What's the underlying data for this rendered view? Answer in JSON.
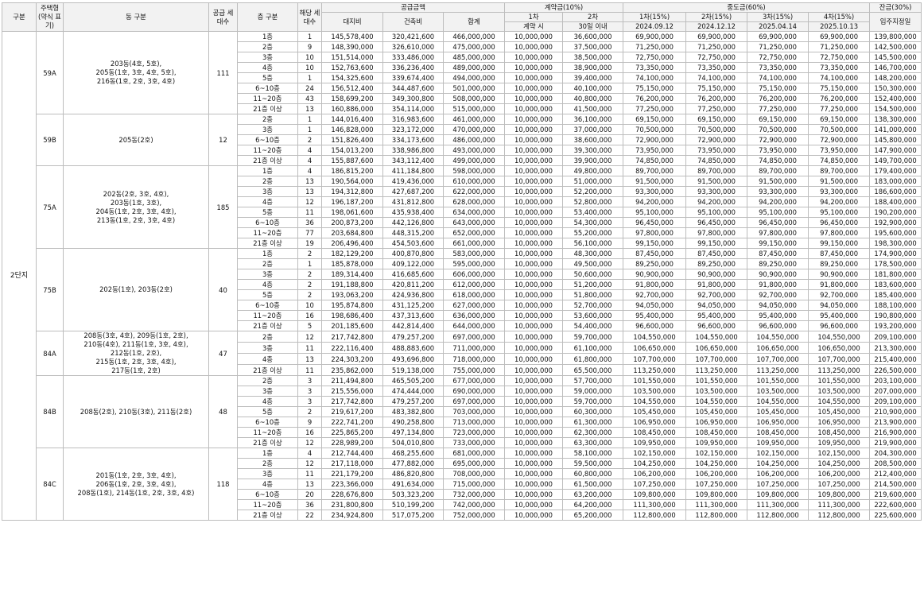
{
  "header": {
    "r1": [
      "구분",
      "주택형 (약식 표기)",
      "동 구분",
      "공급 세대수",
      "층 구분",
      "해당 세대수",
      "공급금액",
      "계약금(10%)",
      "중도금(60%)",
      "잔금(30%)"
    ],
    "r2": [
      "대지비",
      "건축비",
      "합계",
      "1차",
      "2차",
      "1차(15%)",
      "2차(15%)",
      "3차(15%)",
      "4차(15%)",
      "입주지정일"
    ],
    "r3": [
      "계약 시",
      "30일 이내",
      "2024.09.12",
      "2024.12.12",
      "2025.04.14",
      "2025.10.13"
    ]
  },
  "complex": "2단지",
  "groups": [
    {
      "type": "59A",
      "dong": "203동(4호, 5호),\n205동(1호, 3호, 4호, 5호),\n216동(1호, 2호, 3호, 4호)",
      "total": "111",
      "rows": [
        [
          "1층",
          "1",
          "145,578,400",
          "320,421,600",
          "466,000,000",
          "10,000,000",
          "36,600,000",
          "69,900,000",
          "69,900,000",
          "69,900,000",
          "69,900,000",
          "139,800,000"
        ],
        [
          "2층",
          "9",
          "148,390,000",
          "326,610,000",
          "475,000,000",
          "10,000,000",
          "37,500,000",
          "71,250,000",
          "71,250,000",
          "71,250,000",
          "71,250,000",
          "142,500,000"
        ],
        [
          "3층",
          "10",
          "151,514,000",
          "333,486,000",
          "485,000,000",
          "10,000,000",
          "38,500,000",
          "72,750,000",
          "72,750,000",
          "72,750,000",
          "72,750,000",
          "145,500,000"
        ],
        [
          "4층",
          "10",
          "152,763,600",
          "336,236,400",
          "489,000,000",
          "10,000,000",
          "38,900,000",
          "73,350,000",
          "73,350,000",
          "73,350,000",
          "73,350,000",
          "146,700,000"
        ],
        [
          "5층",
          "1",
          "154,325,600",
          "339,674,400",
          "494,000,000",
          "10,000,000",
          "39,400,000",
          "74,100,000",
          "74,100,000",
          "74,100,000",
          "74,100,000",
          "148,200,000"
        ],
        [
          "6~10층",
          "24",
          "156,512,400",
          "344,487,600",
          "501,000,000",
          "10,000,000",
          "40,100,000",
          "75,150,000",
          "75,150,000",
          "75,150,000",
          "75,150,000",
          "150,300,000"
        ],
        [
          "11~20층",
          "43",
          "158,699,200",
          "349,300,800",
          "508,000,000",
          "10,000,000",
          "40,800,000",
          "76,200,000",
          "76,200,000",
          "76,200,000",
          "76,200,000",
          "152,400,000"
        ],
        [
          "21층 이상",
          "13",
          "160,886,000",
          "354,114,000",
          "515,000,000",
          "10,000,000",
          "41,500,000",
          "77,250,000",
          "77,250,000",
          "77,250,000",
          "77,250,000",
          "154,500,000"
        ]
      ]
    },
    {
      "type": "59B",
      "dong": "205동(2호)",
      "total": "12",
      "rows": [
        [
          "2층",
          "1",
          "144,016,400",
          "316,983,600",
          "461,000,000",
          "10,000,000",
          "36,100,000",
          "69,150,000",
          "69,150,000",
          "69,150,000",
          "69,150,000",
          "138,300,000"
        ],
        [
          "3층",
          "1",
          "146,828,000",
          "323,172,000",
          "470,000,000",
          "10,000,000",
          "37,000,000",
          "70,500,000",
          "70,500,000",
          "70,500,000",
          "70,500,000",
          "141,000,000"
        ],
        [
          "6~10층",
          "2",
          "151,826,400",
          "334,173,600",
          "486,000,000",
          "10,000,000",
          "38,600,000",
          "72,900,000",
          "72,900,000",
          "72,900,000",
          "72,900,000",
          "145,800,000"
        ],
        [
          "11~20층",
          "4",
          "154,013,200",
          "338,986,800",
          "493,000,000",
          "10,000,000",
          "39,300,000",
          "73,950,000",
          "73,950,000",
          "73,950,000",
          "73,950,000",
          "147,900,000"
        ],
        [
          "21층 이상",
          "4",
          "155,887,600",
          "343,112,400",
          "499,000,000",
          "10,000,000",
          "39,900,000",
          "74,850,000",
          "74,850,000",
          "74,850,000",
          "74,850,000",
          "149,700,000"
        ]
      ]
    },
    {
      "type": "75A",
      "dong": "202동(2호, 3호, 4호),\n203동(1호, 3호),\n204동(1호, 2호, 3호, 4호),\n213동(1호, 2호, 3호, 4호)",
      "total": "185",
      "rows": [
        [
          "1층",
          "4",
          "186,815,200",
          "411,184,800",
          "598,000,000",
          "10,000,000",
          "49,800,000",
          "89,700,000",
          "89,700,000",
          "89,700,000",
          "89,700,000",
          "179,400,000"
        ],
        [
          "2층",
          "13",
          "190,564,000",
          "419,436,000",
          "610,000,000",
          "10,000,000",
          "51,000,000",
          "91,500,000",
          "91,500,000",
          "91,500,000",
          "91,500,000",
          "183,000,000"
        ],
        [
          "3층",
          "13",
          "194,312,800",
          "427,687,200",
          "622,000,000",
          "10,000,000",
          "52,200,000",
          "93,300,000",
          "93,300,000",
          "93,300,000",
          "93,300,000",
          "186,600,000"
        ],
        [
          "4층",
          "12",
          "196,187,200",
          "431,812,800",
          "628,000,000",
          "10,000,000",
          "52,800,000",
          "94,200,000",
          "94,200,000",
          "94,200,000",
          "94,200,000",
          "188,400,000"
        ],
        [
          "5층",
          "11",
          "198,061,600",
          "435,938,400",
          "634,000,000",
          "10,000,000",
          "53,400,000",
          "95,100,000",
          "95,100,000",
          "95,100,000",
          "95,100,000",
          "190,200,000"
        ],
        [
          "6~10층",
          "36",
          "200,873,200",
          "442,126,800",
          "643,000,000",
          "10,000,000",
          "54,300,000",
          "96,450,000",
          "96,450,000",
          "96,450,000",
          "96,450,000",
          "192,900,000"
        ],
        [
          "11~20층",
          "77",
          "203,684,800",
          "448,315,200",
          "652,000,000",
          "10,000,000",
          "55,200,000",
          "97,800,000",
          "97,800,000",
          "97,800,000",
          "97,800,000",
          "195,600,000"
        ],
        [
          "21층 이상",
          "19",
          "206,496,400",
          "454,503,600",
          "661,000,000",
          "10,000,000",
          "56,100,000",
          "99,150,000",
          "99,150,000",
          "99,150,000",
          "99,150,000",
          "198,300,000"
        ]
      ]
    },
    {
      "type": "75B",
      "dong": "202동(1호), 203동(2호)",
      "total": "40",
      "rows": [
        [
          "1층",
          "2",
          "182,129,200",
          "400,870,800",
          "583,000,000",
          "10,000,000",
          "48,300,000",
          "87,450,000",
          "87,450,000",
          "87,450,000",
          "87,450,000",
          "174,900,000"
        ],
        [
          "2층",
          "1",
          "185,878,000",
          "409,122,000",
          "595,000,000",
          "10,000,000",
          "49,500,000",
          "89,250,000",
          "89,250,000",
          "89,250,000",
          "89,250,000",
          "178,500,000"
        ],
        [
          "3층",
          "2",
          "189,314,400",
          "416,685,600",
          "606,000,000",
          "10,000,000",
          "50,600,000",
          "90,900,000",
          "90,900,000",
          "90,900,000",
          "90,900,000",
          "181,800,000"
        ],
        [
          "4층",
          "2",
          "191,188,800",
          "420,811,200",
          "612,000,000",
          "10,000,000",
          "51,200,000",
          "91,800,000",
          "91,800,000",
          "91,800,000",
          "91,800,000",
          "183,600,000"
        ],
        [
          "5층",
          "2",
          "193,063,200",
          "424,936,800",
          "618,000,000",
          "10,000,000",
          "51,800,000",
          "92,700,000",
          "92,700,000",
          "92,700,000",
          "92,700,000",
          "185,400,000"
        ],
        [
          "6~10층",
          "10",
          "195,874,800",
          "431,125,200",
          "627,000,000",
          "10,000,000",
          "52,700,000",
          "94,050,000",
          "94,050,000",
          "94,050,000",
          "94,050,000",
          "188,100,000"
        ],
        [
          "11~20층",
          "16",
          "198,686,400",
          "437,313,600",
          "636,000,000",
          "10,000,000",
          "53,600,000",
          "95,400,000",
          "95,400,000",
          "95,400,000",
          "95,400,000",
          "190,800,000"
        ],
        [
          "21층 이상",
          "5",
          "201,185,600",
          "442,814,400",
          "644,000,000",
          "10,000,000",
          "54,400,000",
          "96,600,000",
          "96,600,000",
          "96,600,000",
          "96,600,000",
          "193,200,000"
        ]
      ]
    },
    {
      "type": "84A",
      "dong": "208동(3호, 4호), 209동(1호, 2호),\n210동(4호), 211동(1호, 3호, 4호),\n212동(1호, 2호),\n215동(1호, 2호, 3호, 4호),\n217동(1호, 2호)",
      "total": "47",
      "rows": [
        [
          "2층",
          "12",
          "217,742,800",
          "479,257,200",
          "697,000,000",
          "10,000,000",
          "59,700,000",
          "104,550,000",
          "104,550,000",
          "104,550,000",
          "104,550,000",
          "209,100,000"
        ],
        [
          "3층",
          "11",
          "222,116,400",
          "488,883,600",
          "711,000,000",
          "10,000,000",
          "61,100,000",
          "106,650,000",
          "106,650,000",
          "106,650,000",
          "106,650,000",
          "213,300,000"
        ],
        [
          "4층",
          "13",
          "224,303,200",
          "493,696,800",
          "718,000,000",
          "10,000,000",
          "61,800,000",
          "107,700,000",
          "107,700,000",
          "107,700,000",
          "107,700,000",
          "215,400,000"
        ],
        [
          "21층 이상",
          "11",
          "235,862,000",
          "519,138,000",
          "755,000,000",
          "10,000,000",
          "65,500,000",
          "113,250,000",
          "113,250,000",
          "113,250,000",
          "113,250,000",
          "226,500,000"
        ]
      ]
    },
    {
      "type": "84B",
      "dong": "208동(2호), 210동(3호), 211동(2호)",
      "total": "48",
      "rows": [
        [
          "2층",
          "3",
          "211,494,800",
          "465,505,200",
          "677,000,000",
          "10,000,000",
          "57,700,000",
          "101,550,000",
          "101,550,000",
          "101,550,000",
          "101,550,000",
          "203,100,000"
        ],
        [
          "3층",
          "3",
          "215,556,000",
          "474,444,000",
          "690,000,000",
          "10,000,000",
          "59,000,000",
          "103,500,000",
          "103,500,000",
          "103,500,000",
          "103,500,000",
          "207,000,000"
        ],
        [
          "4층",
          "3",
          "217,742,800",
          "479,257,200",
          "697,000,000",
          "10,000,000",
          "59,700,000",
          "104,550,000",
          "104,550,000",
          "104,550,000",
          "104,550,000",
          "209,100,000"
        ],
        [
          "5층",
          "2",
          "219,617,200",
          "483,382,800",
          "703,000,000",
          "10,000,000",
          "60,300,000",
          "105,450,000",
          "105,450,000",
          "105,450,000",
          "105,450,000",
          "210,900,000"
        ],
        [
          "6~10층",
          "9",
          "222,741,200",
          "490,258,800",
          "713,000,000",
          "10,000,000",
          "61,300,000",
          "106,950,000",
          "106,950,000",
          "106,950,000",
          "106,950,000",
          "213,900,000"
        ],
        [
          "11~20층",
          "16",
          "225,865,200",
          "497,134,800",
          "723,000,000",
          "10,000,000",
          "62,300,000",
          "108,450,000",
          "108,450,000",
          "108,450,000",
          "108,450,000",
          "216,900,000"
        ],
        [
          "21층 이상",
          "12",
          "228,989,200",
          "504,010,800",
          "733,000,000",
          "10,000,000",
          "63,300,000",
          "109,950,000",
          "109,950,000",
          "109,950,000",
          "109,950,000",
          "219,900,000"
        ]
      ]
    },
    {
      "type": "84C",
      "dong": "201동(1호, 2호, 3호, 4호),\n206동(1호, 2호, 3호, 4호),\n208동(1호), 214동(1호, 2호, 3호, 4호)",
      "total": "118",
      "rows": [
        [
          "1층",
          "4",
          "212,744,400",
          "468,255,600",
          "681,000,000",
          "10,000,000",
          "58,100,000",
          "102,150,000",
          "102,150,000",
          "102,150,000",
          "102,150,000",
          "204,300,000"
        ],
        [
          "2층",
          "12",
          "217,118,000",
          "477,882,000",
          "695,000,000",
          "10,000,000",
          "59,500,000",
          "104,250,000",
          "104,250,000",
          "104,250,000",
          "104,250,000",
          "208,500,000"
        ],
        [
          "3층",
          "11",
          "221,179,200",
          "486,820,800",
          "708,000,000",
          "10,000,000",
          "60,800,000",
          "106,200,000",
          "106,200,000",
          "106,200,000",
          "106,200,000",
          "212,400,000"
        ],
        [
          "4층",
          "13",
          "223,366,000",
          "491,634,000",
          "715,000,000",
          "10,000,000",
          "61,500,000",
          "107,250,000",
          "107,250,000",
          "107,250,000",
          "107,250,000",
          "214,500,000"
        ],
        [
          "6~10층",
          "20",
          "228,676,800",
          "503,323,200",
          "732,000,000",
          "10,000,000",
          "63,200,000",
          "109,800,000",
          "109,800,000",
          "109,800,000",
          "109,800,000",
          "219,600,000"
        ],
        [
          "11~20층",
          "36",
          "231,800,800",
          "510,199,200",
          "742,000,000",
          "10,000,000",
          "64,200,000",
          "111,300,000",
          "111,300,000",
          "111,300,000",
          "111,300,000",
          "222,600,000"
        ],
        [
          "21층 이상",
          "22",
          "234,924,800",
          "517,075,200",
          "752,000,000",
          "10,000,000",
          "65,200,000",
          "112,800,000",
          "112,800,000",
          "112,800,000",
          "112,800,000",
          "225,600,000"
        ]
      ]
    }
  ]
}
